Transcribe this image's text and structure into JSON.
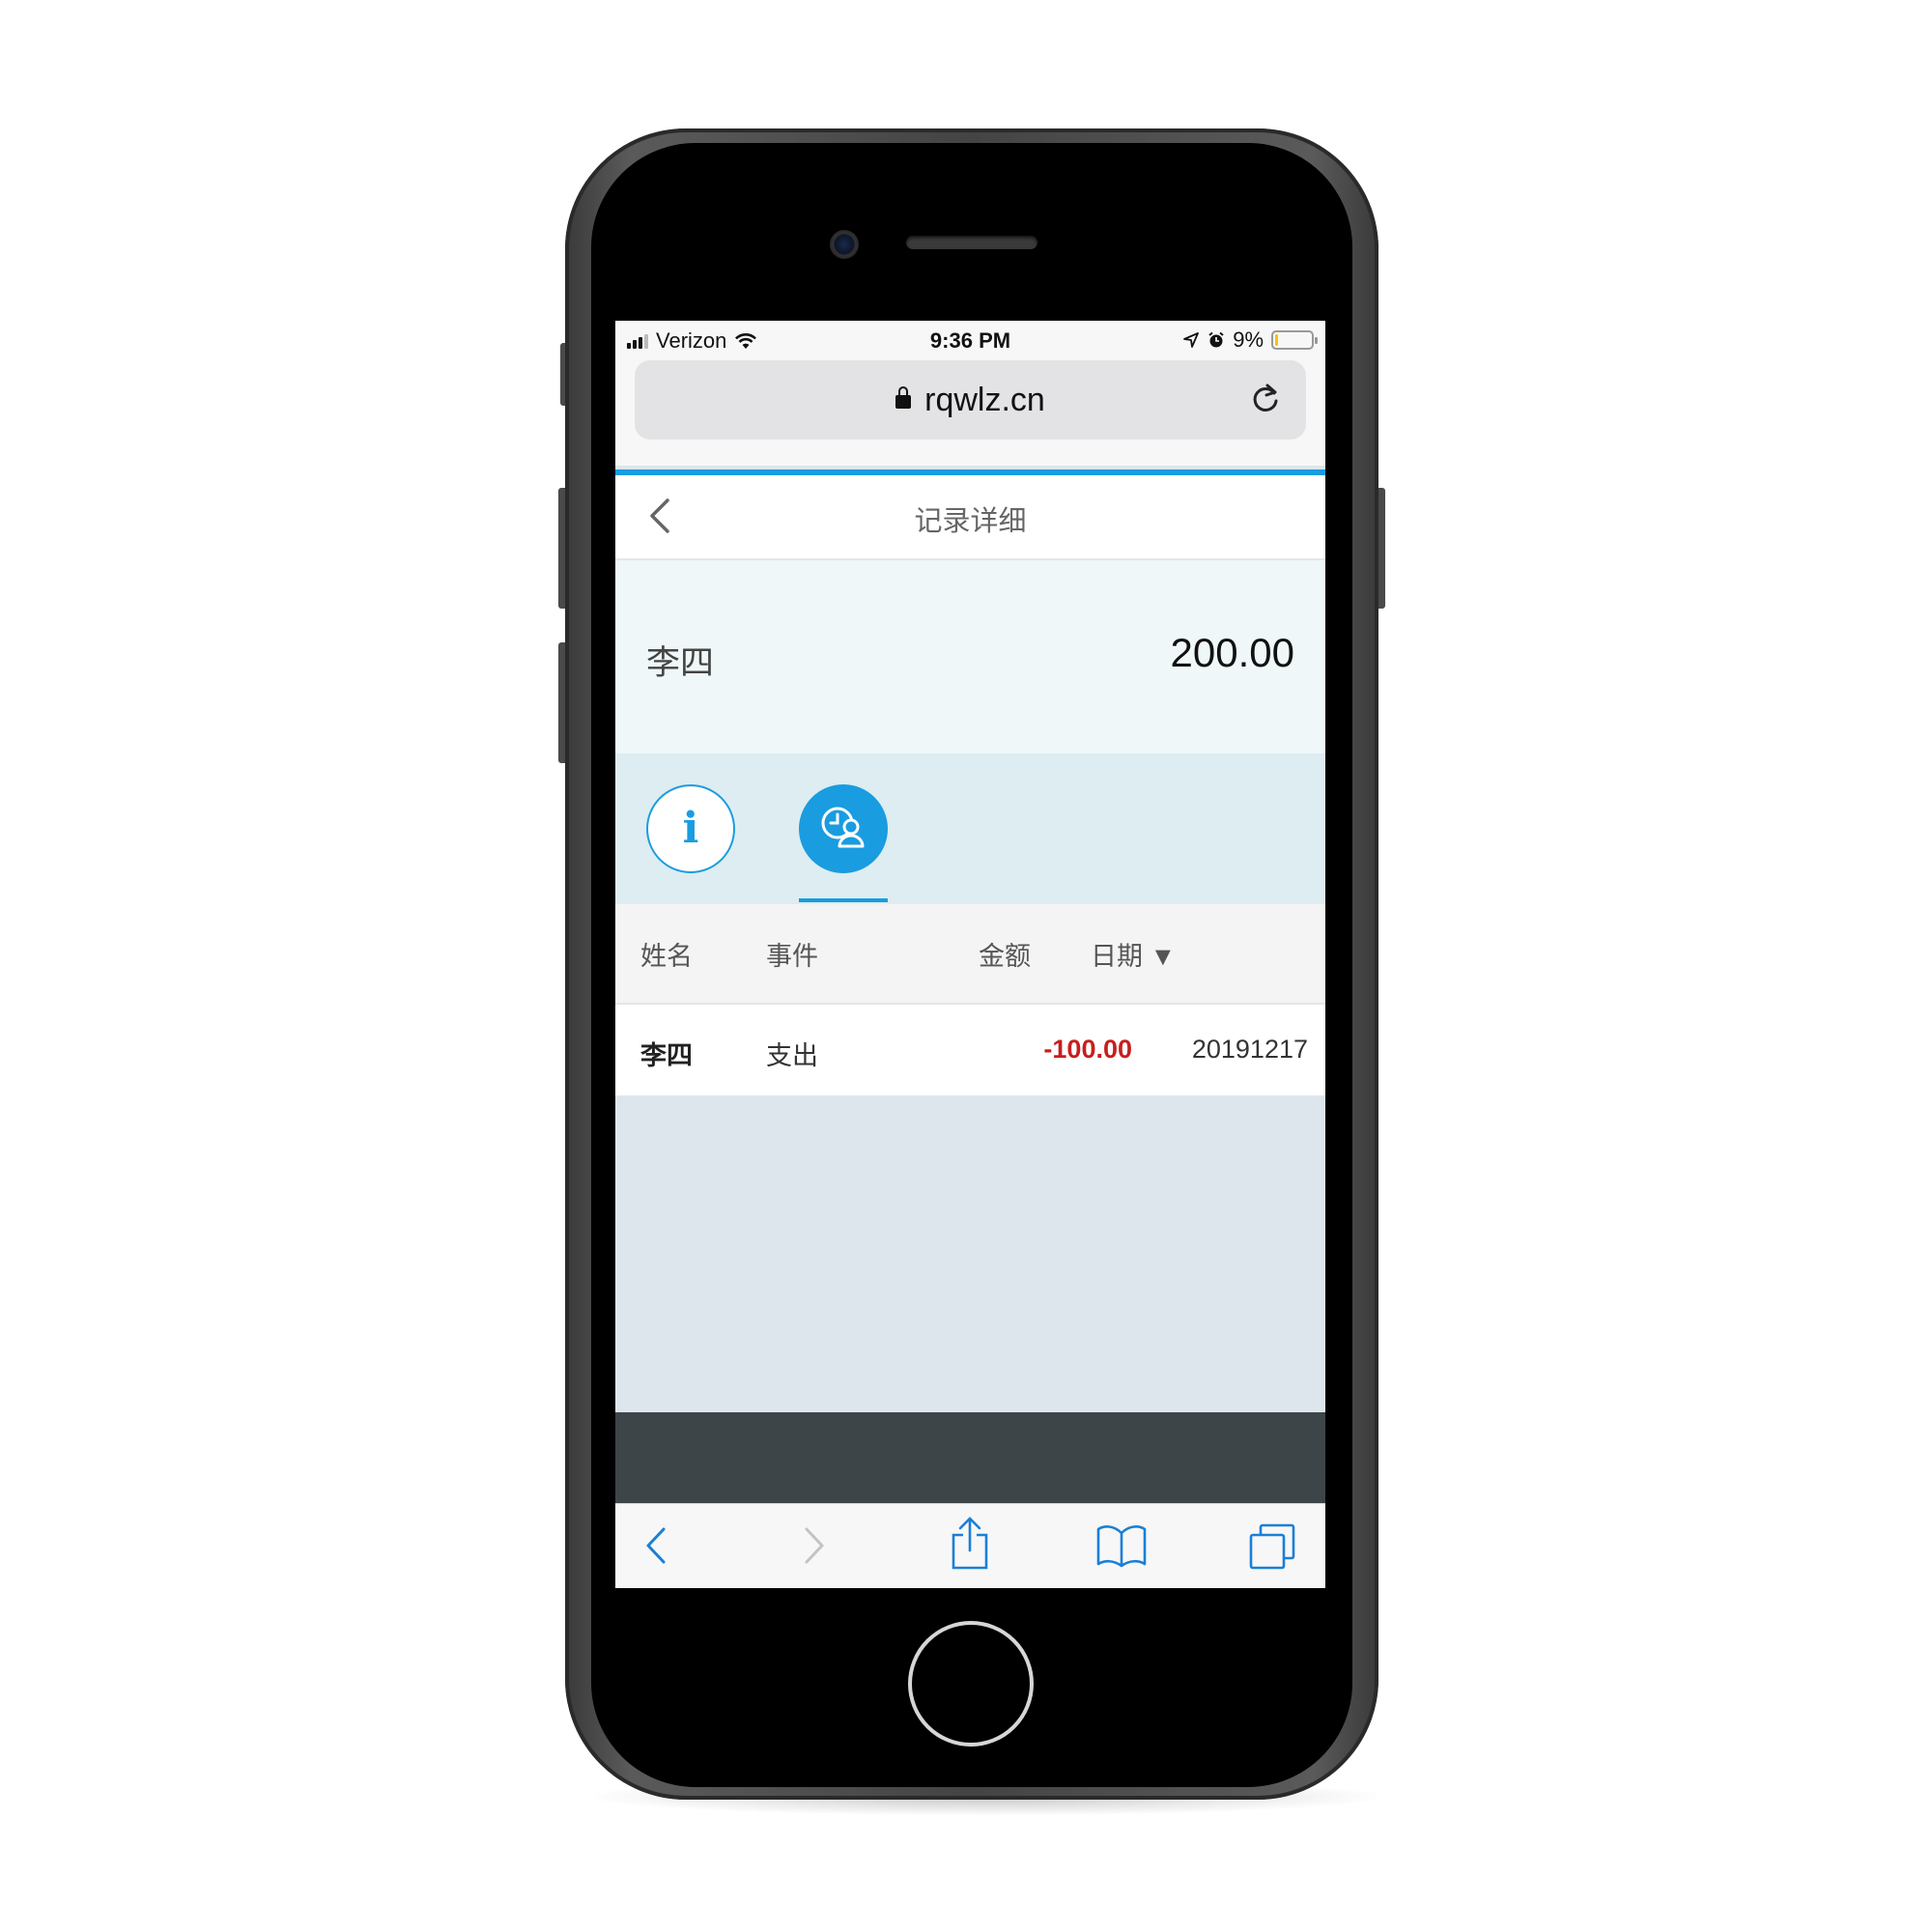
{
  "status_bar": {
    "carrier": "Verizon",
    "time": "9:36 PM",
    "battery_percent": "9%",
    "battery_level": 0.09
  },
  "browser": {
    "url": "rqwlz.cn"
  },
  "page": {
    "title": "记录详细",
    "summary_name": "李四",
    "summary_amount": "200.00",
    "tabs": [
      {
        "icon": "info-icon",
        "label": "i"
      },
      {
        "icon": "history-person-icon"
      }
    ],
    "active_tab": 1
  },
  "table": {
    "headers": {
      "name": "姓名",
      "event": "事件",
      "amount": "金额",
      "date": "日期 ▼"
    },
    "rows": [
      {
        "name": "李四",
        "event": "支出",
        "amount": "-100.00",
        "date": "20191217"
      }
    ]
  },
  "colors": {
    "accent": "#1a9ce0",
    "negative": "#c81e1e"
  }
}
